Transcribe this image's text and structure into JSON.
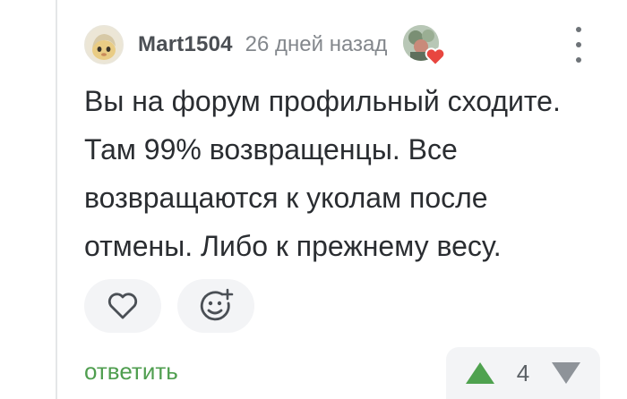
{
  "comment": {
    "username": "Mart1504",
    "timestamp": "26 дней назад",
    "text_lines": [
      "Вы на форум профильный сходите.",
      "Там 99% возвращенцы. Все",
      "возвращаются к уколам после",
      "отмены. Либо к прежнему весу."
    ]
  },
  "actions": {
    "like_icon": "heart-outline-icon",
    "react_icon": "smiley-plus-icon"
  },
  "footer": {
    "reply_label": "ответить",
    "rating": "4",
    "upvote_icon": "triangle-up-icon",
    "downvote_icon": "triangle-down-icon"
  },
  "colors": {
    "accent_green": "#4f9e4f",
    "upvote_green": "#4fa24f",
    "downvote_grey": "#8e9399",
    "username": "#4b4f54",
    "text": "#2a2d31"
  }
}
